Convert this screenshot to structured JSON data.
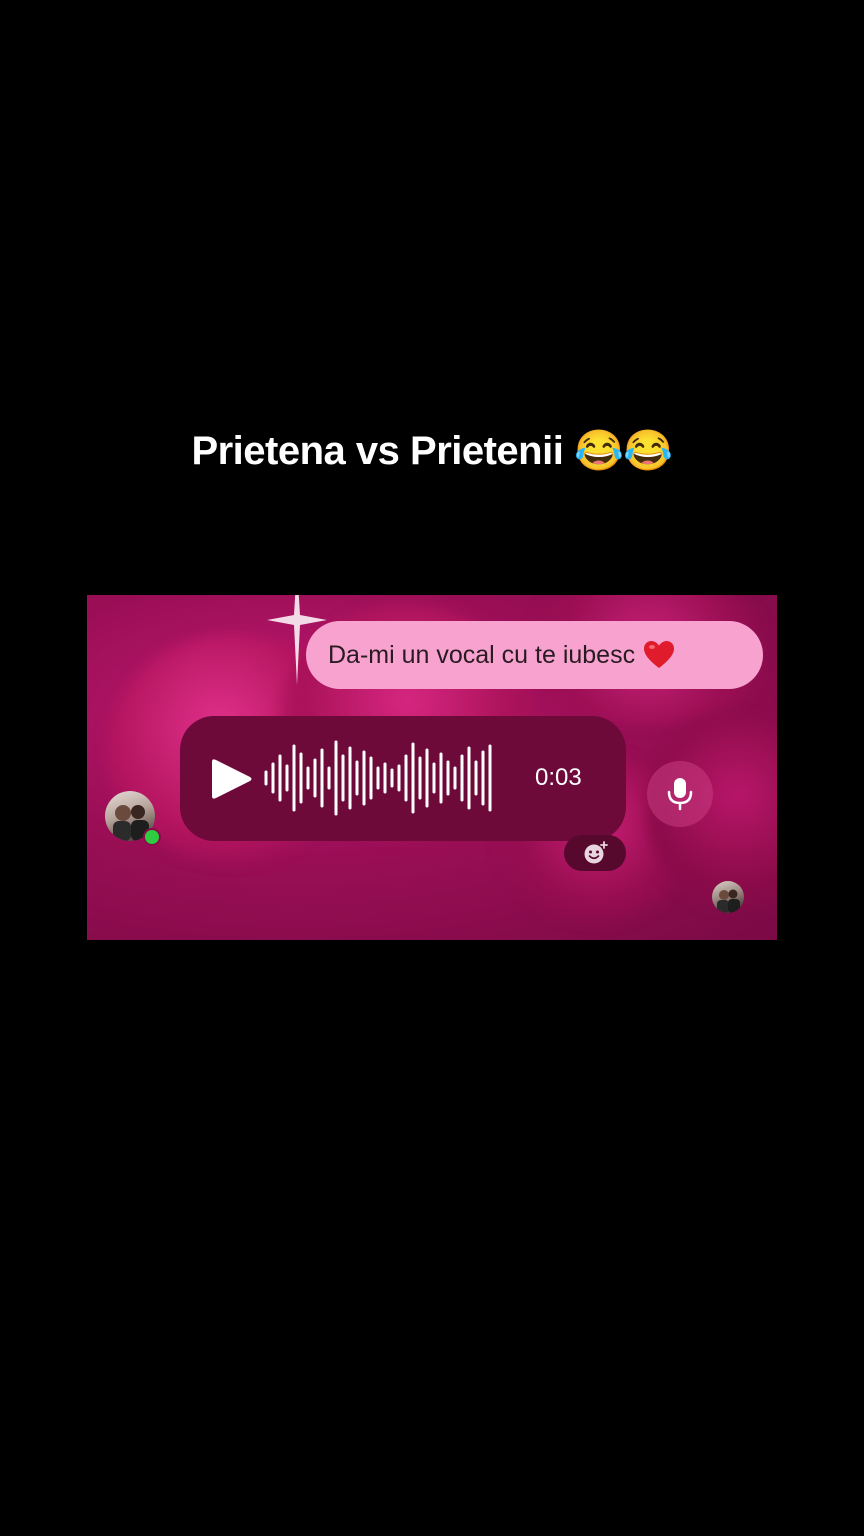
{
  "caption": {
    "text": "Prietena vs Prietenii 😂😂"
  },
  "chat": {
    "sent_message": {
      "text": "Da-mi un vocal cu te iubesc",
      "emoji": "red-heart-icon"
    },
    "voice_message": {
      "duration": "0:03",
      "play_icon": "play-icon",
      "waveform_icon": "waveform-icon"
    },
    "mic_button_icon": "microphone-icon",
    "react_button_icon": "add-reaction-icon",
    "online_status_color": "#2ecc40"
  },
  "colors": {
    "background": "#000000",
    "chat_background": "#9a0e56",
    "sent_bubble": "#f8a3cf",
    "voice_bubble": "#6e0a3a"
  }
}
